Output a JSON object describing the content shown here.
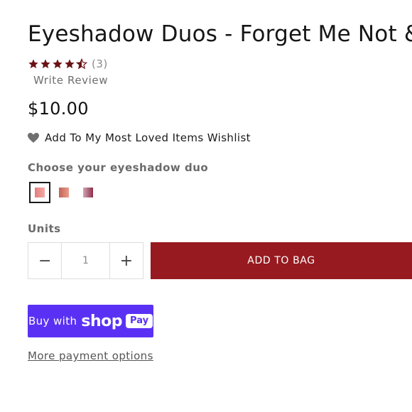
{
  "product": {
    "title": "Eyeshadow Duos - Forget Me Not &",
    "rating": 4.5,
    "review_count": "(3)",
    "write_review": "Write Review",
    "price": "$10.00"
  },
  "wishlist": {
    "label": "Add To My Most Loved Items Wishlist"
  },
  "variant": {
    "label": "Choose your eyeshadow duo",
    "selected_index": 0,
    "swatch_count": 3
  },
  "quantity": {
    "label": "Units",
    "value": "1",
    "minus": "−",
    "plus": "+"
  },
  "actions": {
    "add_to_bag": "ADD TO BAG",
    "buy_with": "Buy with",
    "shop": "shop",
    "pay": "Pay",
    "more_payment": "More payment options"
  },
  "colors": {
    "accent": "#961a1f",
    "star": "#6b1216",
    "shop_pay": "#5a31f4"
  }
}
